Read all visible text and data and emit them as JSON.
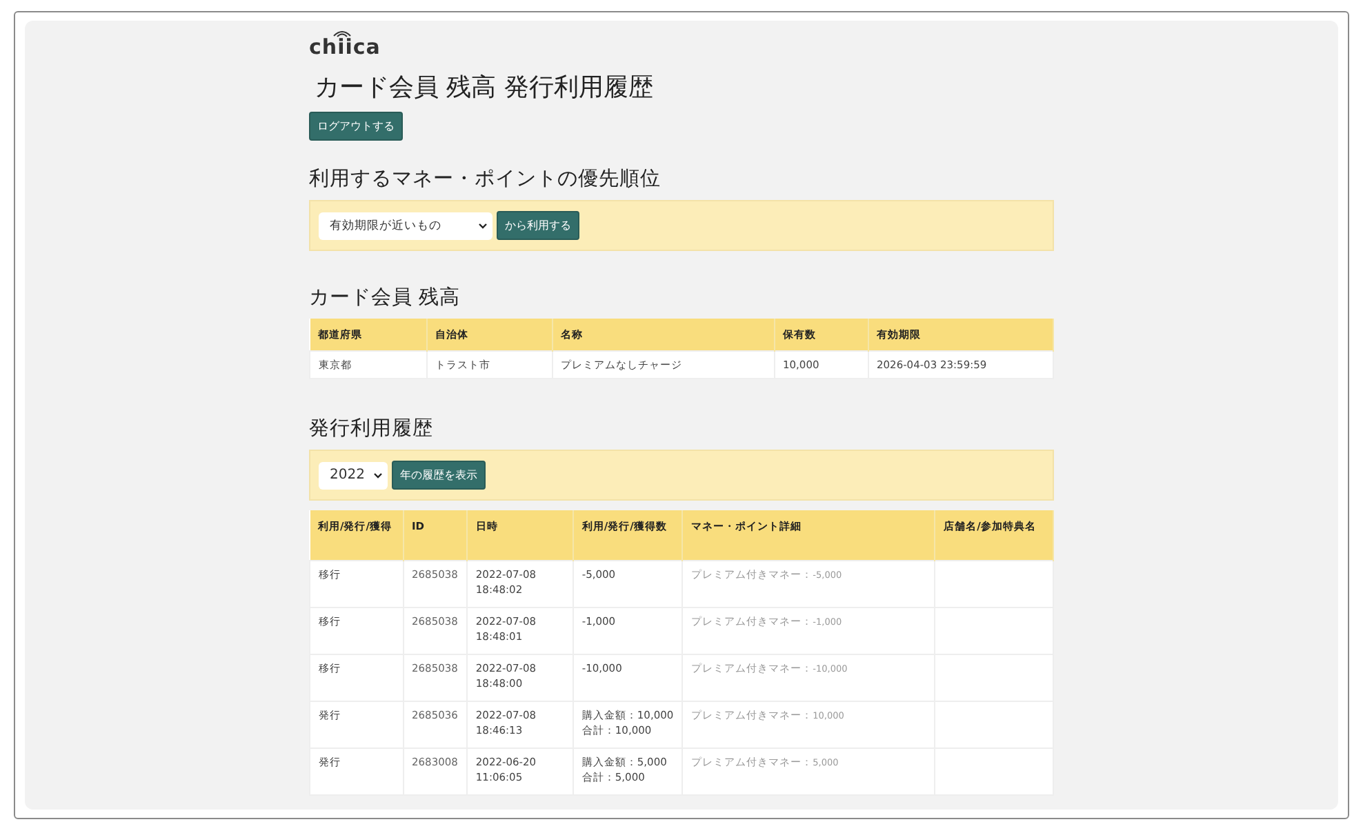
{
  "logo": "chiica",
  "title": "カード会員 残高 発行利用履歴",
  "logout_button": "ログアウトする",
  "priority": {
    "heading": "利用するマネー・ポイントの優先順位",
    "select": "有効期限が近いもの",
    "button": "から利用する"
  },
  "balance": {
    "heading": "カード会員 残高",
    "columns": [
      "都道府県",
      "自治体",
      "名称",
      "保有数",
      "有効期限"
    ],
    "rows": [
      [
        "東京都",
        "トラスト市",
        "プレミアムなしチャージ",
        "10,000",
        "2026-04-03 23:59:59"
      ]
    ]
  },
  "history": {
    "heading": "発行利用履歴",
    "year_select": "2022",
    "button": "年の履歴を表示",
    "columns": [
      "利用/発行/獲得",
      "ID",
      "日時",
      "利用/発行/獲得数",
      "マネー・ポイント詳細",
      "店舗名/参加特典名"
    ],
    "rows": [
      {
        "type": "移行",
        "id": "2685038",
        "datetime": "2022-07-08 18:48:02",
        "amount": [
          "-5,000"
        ],
        "detail": "プレミアム付きマネー：",
        "detail_value": "-5,000"
      },
      {
        "type": "移行",
        "id": "2685038",
        "datetime": "2022-07-08 18:48:01",
        "amount": [
          "-1,000"
        ],
        "detail": "プレミアム付きマネー：",
        "detail_value": "-1,000"
      },
      {
        "type": "移行",
        "id": "2685038",
        "datetime": "2022-07-08 18:48:00",
        "amount": [
          "-10,000"
        ],
        "detail": "プレミアム付きマネー：",
        "detail_value": "-10,000"
      },
      {
        "type": "発行",
        "id": "2685036",
        "datetime": "2022-07-08 18:46:13",
        "amount": [
          "購入金額：10,000",
          "合計：10,000"
        ],
        "detail": "プレミアム付きマネー：",
        "detail_value": "10,000"
      },
      {
        "type": "発行",
        "id": "2683008",
        "datetime": "2022-06-20 11:06:05",
        "amount": [
          "購入金額：5,000",
          "合計：5,000"
        ],
        "detail": "プレミアム付きマネー：",
        "detail_value": "5,000"
      }
    ]
  }
}
